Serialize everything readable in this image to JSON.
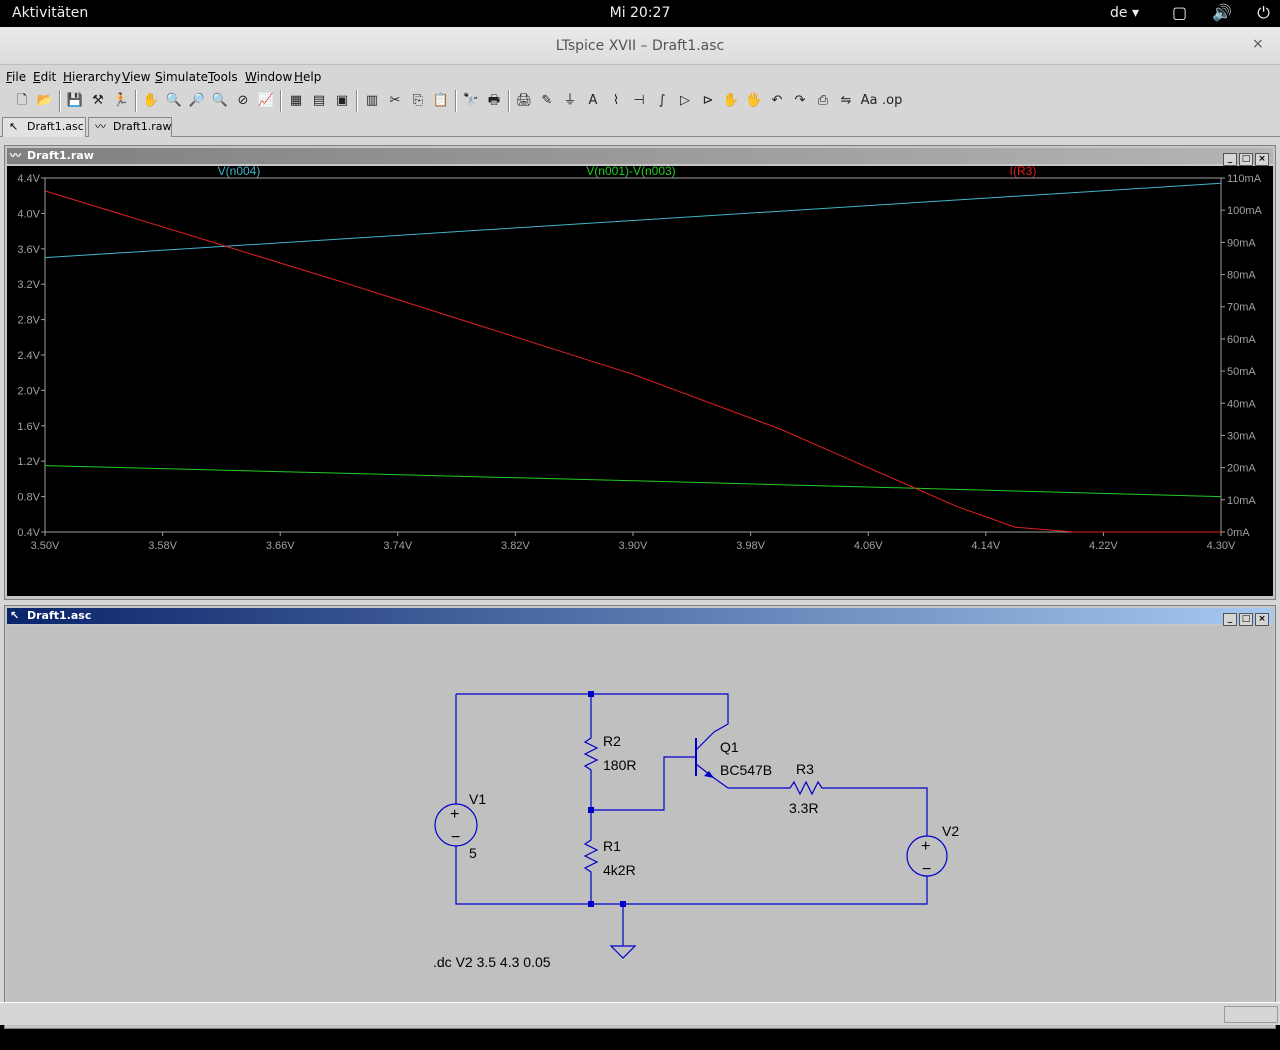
{
  "topbar": {
    "activities": "Aktivitäten",
    "clock": "Mi 20:27",
    "language": "de ▾",
    "system_icons": "▢ 🔊 ⏻ ▾"
  },
  "window": {
    "title": "LTspice XVII – Draft1.asc",
    "close": "×"
  },
  "menu": [
    "File",
    "Edit",
    "Hierarchy",
    "View",
    "Simulate",
    "Tools",
    "Window",
    "Help"
  ],
  "toolbar": {
    "icons": [
      "new-schematic-icon",
      "open-icon",
      "save-icon",
      "control-panel-icon",
      "run-icon",
      "halt-icon",
      "zoom-in-icon",
      "zoom-area-icon",
      "zoom-out-icon",
      "zoom-cancel-icon",
      "autorange-icon",
      "grid-icon",
      "tile-horizontal-icon",
      "cascade-icon",
      "tile-vertical-icon",
      "cut-icon",
      "copy-icon",
      "paste-icon",
      "find-icon",
      "print-setup-icon",
      "print-icon",
      "wire-icon",
      "ground-icon",
      "label-icon",
      "resistor-icon",
      "capacitor-icon",
      "inductor-icon",
      "diode-icon",
      "component-icon",
      "move-icon",
      "drag-icon",
      "undo-icon",
      "redo-icon",
      "rotate-icon",
      "mirror-icon",
      "text-icon",
      "spice-directive-icon"
    ],
    "glyphs": [
      "🗋",
      "📂",
      "💾",
      "⚒",
      "🏃",
      "✋",
      "🔍",
      "🔎",
      "🔍",
      "⊘",
      "📈",
      "▦",
      "▤",
      "▣",
      "▥",
      "✂",
      "⎘",
      "📋",
      "🔭",
      "🖶",
      "🖨",
      "✎",
      "⏚",
      "A",
      "⌇",
      "⊣",
      "∫",
      "▷",
      "⊳",
      "✋",
      "🖐",
      "↶",
      "↷",
      "⎙",
      "⇋",
      "Aa",
      ".op"
    ]
  },
  "tabs": [
    {
      "label": "Draft1.asc",
      "icon": "↖"
    },
    {
      "label": "Draft1.raw",
      "icon": "〰"
    }
  ],
  "waveform": {
    "window_title": "Draft1.raw",
    "window_icon": "〰",
    "buttons": [
      "_",
      "□",
      "×"
    ]
  },
  "schematic": {
    "window_title": "Draft1.asc",
    "window_icon": "↖",
    "buttons": [
      "_",
      "□",
      "×"
    ],
    "labels": {
      "V1": "V1",
      "V1_value": "5",
      "R2": "R2",
      "R2_value": "180R",
      "R1": "R1",
      "R1_value": "4k2R",
      "Q1": "Q1",
      "Q1_value": "BC547B",
      "R3": "R3",
      "R3_value": "3.3R",
      "V2": "V2",
      "directive": ".dc V2 3.5 4.3 0.05"
    },
    "wire_color": "#0000cc"
  },
  "chart_data": {
    "type": "line",
    "x_ticks": [
      "3.50V",
      "3.58V",
      "3.66V",
      "3.74V",
      "3.82V",
      "3.90V",
      "3.98V",
      "4.06V",
      "4.14V",
      "4.22V",
      "4.30V"
    ],
    "xlim": [
      3.5,
      4.3
    ],
    "y_left_ticks": [
      "4.4V",
      "4.0V",
      "3.6V",
      "3.2V",
      "2.8V",
      "2.4V",
      "2.0V",
      "1.6V",
      "1.2V",
      "0.8V",
      "0.4V"
    ],
    "ylim_left": [
      0.4,
      4.4
    ],
    "y_right_ticks": [
      "110mA",
      "100mA",
      "90mA",
      "80mA",
      "70mA",
      "60mA",
      "50mA",
      "40mA",
      "30mA",
      "20mA",
      "10mA",
      "0mA"
    ],
    "ylim_right": [
      0,
      110
    ],
    "grid": false,
    "x": [
      3.5,
      3.6,
      3.7,
      3.8,
      3.9,
      4.0,
      4.04,
      4.08,
      4.12,
      4.16,
      4.2,
      4.3
    ],
    "series": [
      {
        "name": "V(n004)",
        "color": "#3fb6c8",
        "axis": "left",
        "values": [
          3.5,
          3.605,
          3.71,
          3.815,
          3.92,
          4.025,
          4.067,
          4.109,
          4.151,
          4.193,
          4.235,
          4.34
        ]
      },
      {
        "name": "V(n001)-V(n003)",
        "color": "#22cc22",
        "axis": "left",
        "values": [
          1.15,
          1.107,
          1.065,
          1.022,
          0.98,
          0.935,
          0.917,
          0.899,
          0.881,
          0.863,
          0.845,
          0.8
        ]
      },
      {
        "name": "I(R3)",
        "color": "#e02020",
        "axis": "right",
        "values": [
          106,
          92,
          78,
          63.5,
          49,
          32,
          24,
          16,
          8,
          1.5,
          0,
          0
        ]
      }
    ]
  }
}
